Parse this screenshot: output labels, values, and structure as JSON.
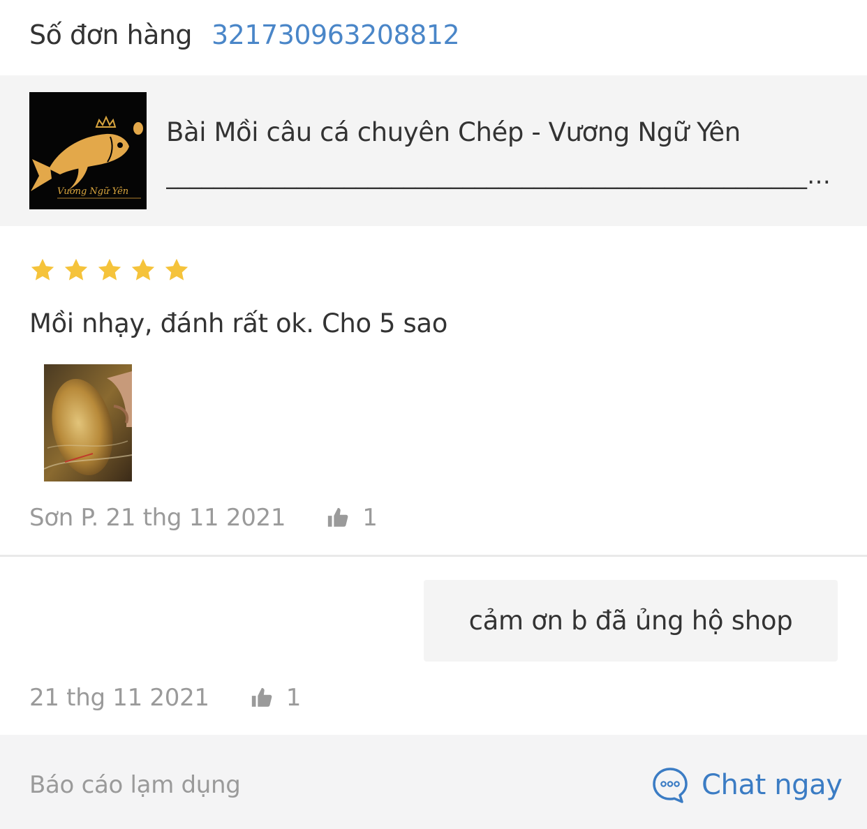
{
  "order": {
    "label": "Số đơn hàng",
    "number": "321730963208812"
  },
  "product": {
    "title": "Bài Mồi câu cá chuyên Chép - Vương Ngữ Yên",
    "subtitle": "_______________________________________________________________________...",
    "thumb_caption": "Vương Ngữ Yên",
    "thumb_icon": "golden-fish-crown-logo"
  },
  "review": {
    "rating": 5,
    "max_rating": 5,
    "star_color": "#f5c33b",
    "text": "Mồi nhạy, đánh rất ok. Cho 5 sao",
    "author": "Sơn P.",
    "date": "21 thg 11 2021",
    "likes": "1",
    "photo_icon": "caught-carp-photo"
  },
  "reply": {
    "text": "cảm ơn b đã ủng hộ shop",
    "date": "21 thg 11 2021",
    "likes": "1"
  },
  "footer": {
    "report_label": "Báo cáo lạm dụng",
    "chat_label": "Chat ngay",
    "chat_icon": "chat-bubble-icon",
    "accent_color": "#3b7cc4"
  }
}
